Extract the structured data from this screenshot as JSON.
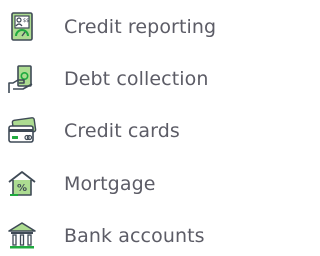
{
  "menu": {
    "items": [
      {
        "label": "Credit reporting",
        "icon": "credit-report-icon"
      },
      {
        "label": "Debt collection",
        "icon": "debt-collection-icon"
      },
      {
        "label": "Credit cards",
        "icon": "credit-cards-icon"
      },
      {
        "label": "Mortgage",
        "icon": "mortgage-icon"
      },
      {
        "label": "Bank accounts",
        "icon": "bank-icon"
      }
    ]
  },
  "colors": {
    "icon_line": "#3f4a56",
    "icon_accent": "#20aa3f",
    "icon_accent_light": "#addc91",
    "label_text": "#5c5c66"
  }
}
